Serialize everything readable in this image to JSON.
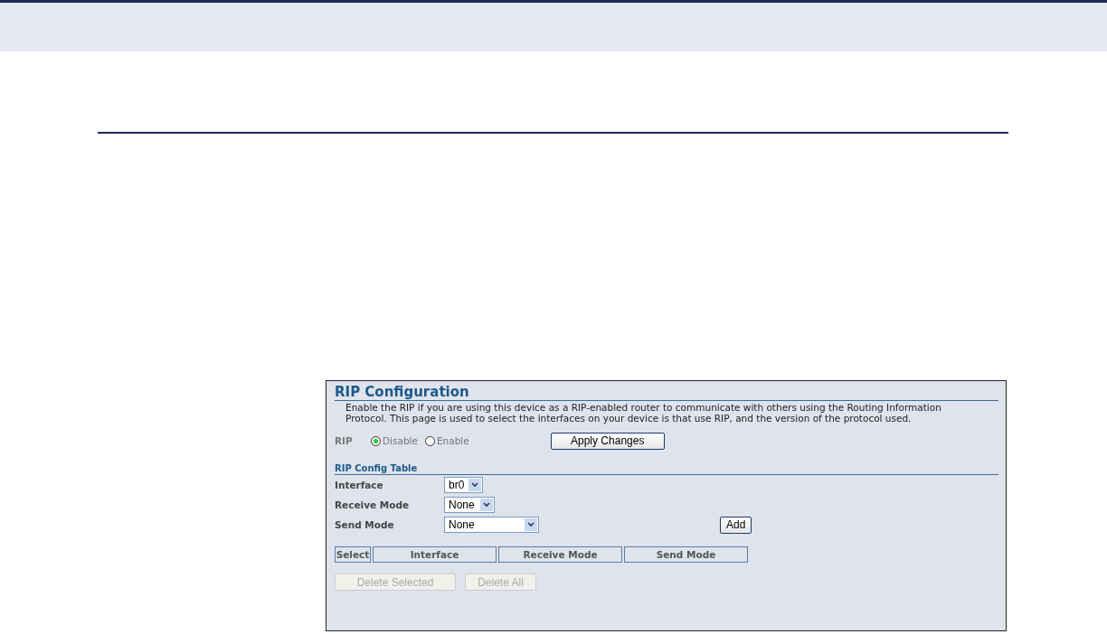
{
  "panel": {
    "title": "RIP Configuration",
    "description": "Enable the RIP if you are using this device as a RIP-enabled router to communicate with others using the Routing Information Protocol. This page is used to select the interfaces on your device is that use RIP, and the version of the protocol used.",
    "rip": {
      "label": "RIP",
      "options": [
        {
          "label": "Disable",
          "selected": true
        },
        {
          "label": "Enable",
          "selected": false
        }
      ],
      "apply_button": "Apply Changes"
    },
    "table_title": "RIP Config Table",
    "fields": [
      {
        "label": "Interface",
        "value": "br0"
      },
      {
        "label": "Receive Mode",
        "value": "None"
      },
      {
        "label": "Send Mode",
        "value": "None"
      }
    ],
    "add_button": "Add",
    "columns": [
      "Select",
      "Interface",
      "Receive Mode",
      "Send Mode"
    ],
    "buttons": [
      {
        "label": "Delete Selected",
        "disabled": true
      },
      {
        "label": "Delete All",
        "disabled": true
      }
    ]
  }
}
